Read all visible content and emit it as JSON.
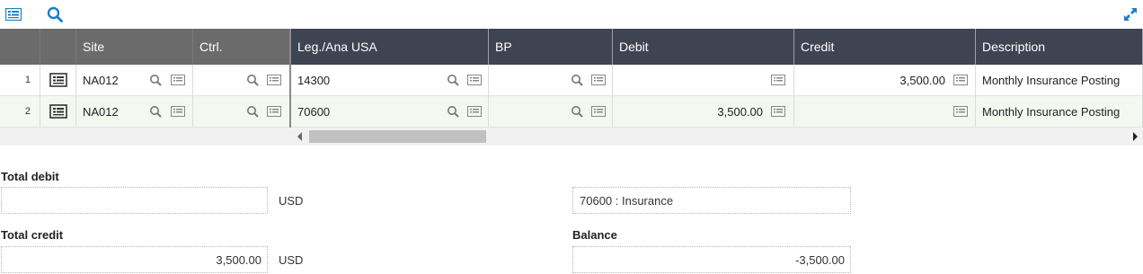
{
  "toolbar": {
    "list_icon": "list-icon",
    "search_icon": "search-icon",
    "expand_icon": "expand-icon"
  },
  "colors": {
    "accent": "#1a7fc4",
    "header_fixed": "#6b6b6b",
    "header_scroll": "#3f4452",
    "alt_row": "#f3f8f1"
  },
  "grid": {
    "columns": [
      "Site",
      "Ctrl.",
      "Leg./Ana USA",
      "BP",
      "Debit",
      "Credit",
      "Description"
    ],
    "rows": [
      {
        "num": "1",
        "site": "NA012",
        "ctrl": "",
        "account": "14300",
        "bp": "",
        "debit": "",
        "credit": "3,500.00",
        "description": "Monthly Insurance Posting"
      },
      {
        "num": "2",
        "site": "NA012",
        "ctrl": "",
        "account": "70600",
        "bp": "",
        "debit": "3,500.00",
        "credit": "",
        "description": "Monthly Insurance Posting"
      }
    ]
  },
  "totals": {
    "total_debit_label": "Total debit",
    "total_debit_value": "",
    "total_debit_currency": "USD",
    "total_credit_label": "Total credit",
    "total_credit_value": "3,500.00",
    "total_credit_currency": "USD",
    "account_desc_value": "70600 : Insurance",
    "balance_label": "Balance",
    "balance_value": "-3,500.00"
  }
}
